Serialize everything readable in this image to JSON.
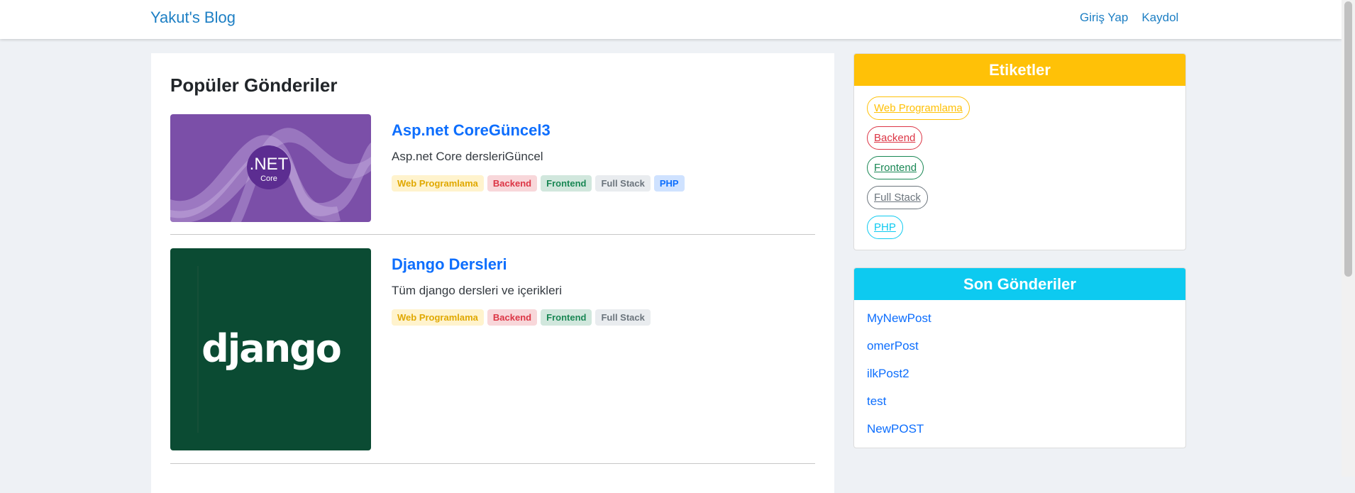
{
  "navbar": {
    "brand": "Yakut's Blog",
    "links": [
      {
        "label": "Giriş Yap"
      },
      {
        "label": "Kaydol"
      }
    ]
  },
  "main": {
    "title": "Popüler Gönderiler",
    "posts": [
      {
        "title": "Asp.net CoreGüncel3",
        "description": "Asp.net Core dersleriGüncel",
        "image_text": ".NET",
        "image_subtext": "Core",
        "tags": [
          "Web Programlama",
          "Backend",
          "Frontend",
          "Full Stack",
          "PHP"
        ]
      },
      {
        "title": "Django Dersleri",
        "description": "Tüm django dersleri ve içerikleri",
        "image_text": "django",
        "tags": [
          "Web Programlama",
          "Backend",
          "Frontend",
          "Full Stack"
        ]
      }
    ]
  },
  "sidebar": {
    "tags_header": "Etiketler",
    "tags": [
      "Web Programlama",
      "Backend",
      "Frontend",
      "Full Stack",
      "PHP"
    ],
    "recent_header": "Son Gönderiler",
    "recent_posts": [
      "MyNewPost",
      "omerPost",
      "ilkPost2",
      "test",
      "NewPOST"
    ]
  },
  "colors": {
    "brand_link": "#1d7fc4",
    "etiketler_header": "#ffc107",
    "son_gonderiler_header": "#0dcaf0",
    "dotnet_purple": "#7b4fa8",
    "django_green": "#0b4b33"
  }
}
